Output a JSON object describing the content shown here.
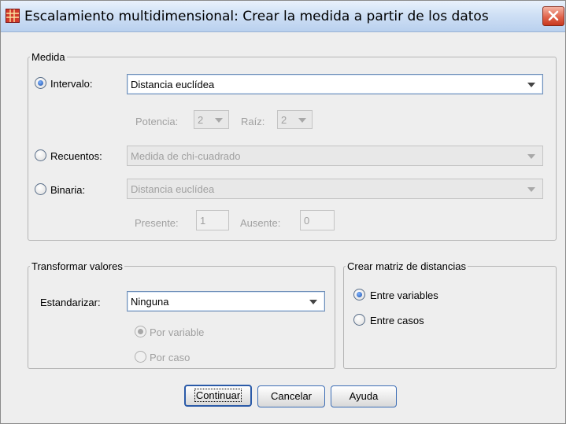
{
  "window": {
    "title": "Escalamiento multidimensional: Crear la medida a partir de los datos",
    "icon": "spss-grid-icon",
    "close_icon": "close-icon"
  },
  "measure": {
    "legend": "Medida",
    "interval": {
      "label": "Intervalo:",
      "selected": true,
      "value": "Distancia euclídea",
      "power_label": "Potencia:",
      "power_value": "2",
      "root_label": "Raíz:",
      "root_value": "2"
    },
    "counts": {
      "label": "Recuentos:",
      "selected": false,
      "value": "Medida de chi-cuadrado"
    },
    "binary": {
      "label": "Binaria:",
      "selected": false,
      "value": "Distancia euclídea",
      "present_label": "Presente:",
      "present_value": "1",
      "absent_label": "Ausente:",
      "absent_value": "0"
    }
  },
  "transform": {
    "legend": "Transformar valores",
    "standardize_label": "Estandarizar:",
    "standardize_value": "Ninguna",
    "by_variable_label": "Por variable",
    "by_variable_selected": true,
    "by_case_label": "Por caso",
    "by_case_selected": false
  },
  "distance_matrix": {
    "legend": "Crear matriz de distancias",
    "between_variables_label": "Entre variables",
    "between_variables_selected": true,
    "between_cases_label": "Entre casos",
    "between_cases_selected": false
  },
  "buttons": {
    "continue": "Continuar",
    "cancel": "Cancelar",
    "help": "Ayuda"
  },
  "colors": {
    "titlebar": "#cfe0f5",
    "close_button": "#e0644c",
    "focus_border": "#2a5aa8"
  }
}
